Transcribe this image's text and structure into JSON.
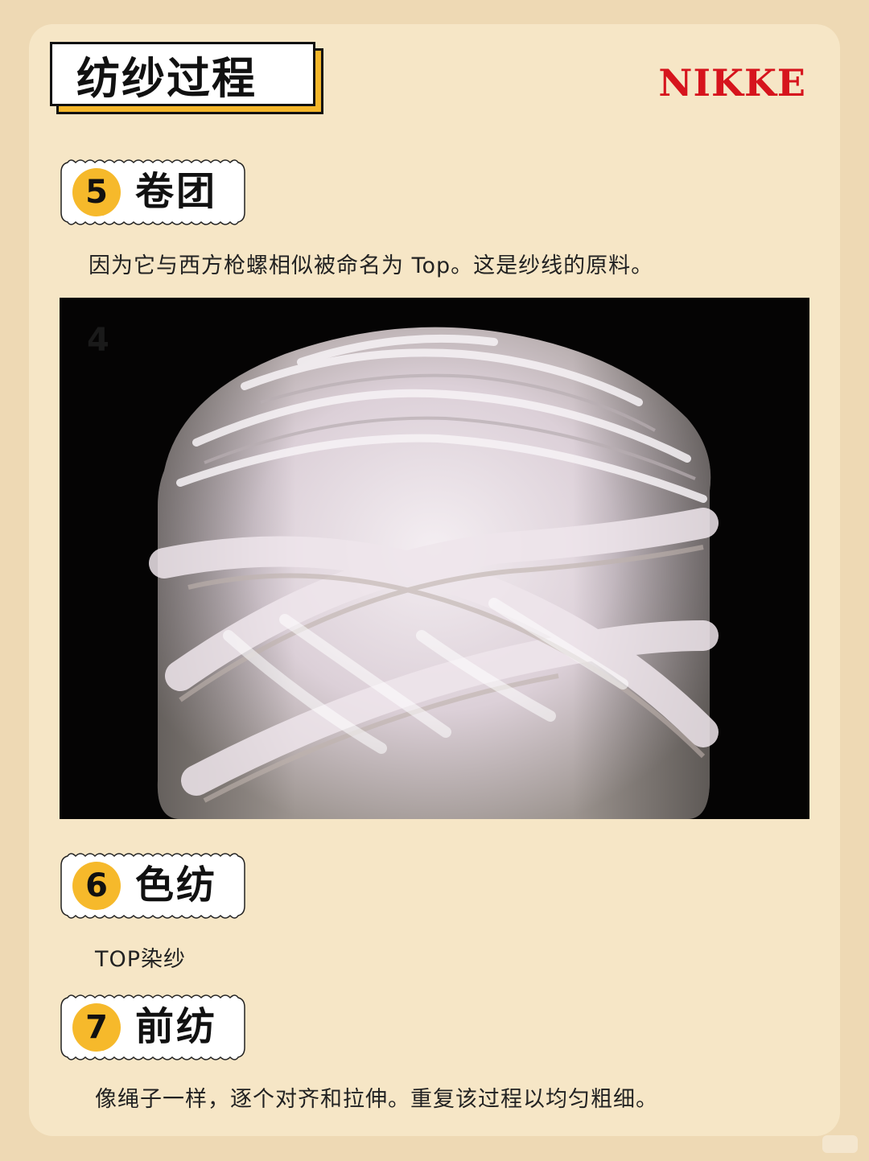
{
  "header": {
    "title": "纺纱过程",
    "brand": "NIKKE"
  },
  "steps": [
    {
      "number": "5",
      "label": "卷团",
      "description": "因为它与西方枪螺相似被命名为 Top。这是纱线的原料。"
    },
    {
      "number": "6",
      "label": "色纺",
      "description": "TOP染纱"
    },
    {
      "number": "7",
      "label": "前纺",
      "description": "像绳子一样，逐个对齐和拉伸。重复该过程以均匀粗细。"
    }
  ],
  "photo": {
    "overlay_digit": "4"
  },
  "colors": {
    "background": "#eed9b4",
    "card": "#f6e6c6",
    "accent_yellow": "#f6b92b",
    "brand_red": "#d6141d"
  }
}
